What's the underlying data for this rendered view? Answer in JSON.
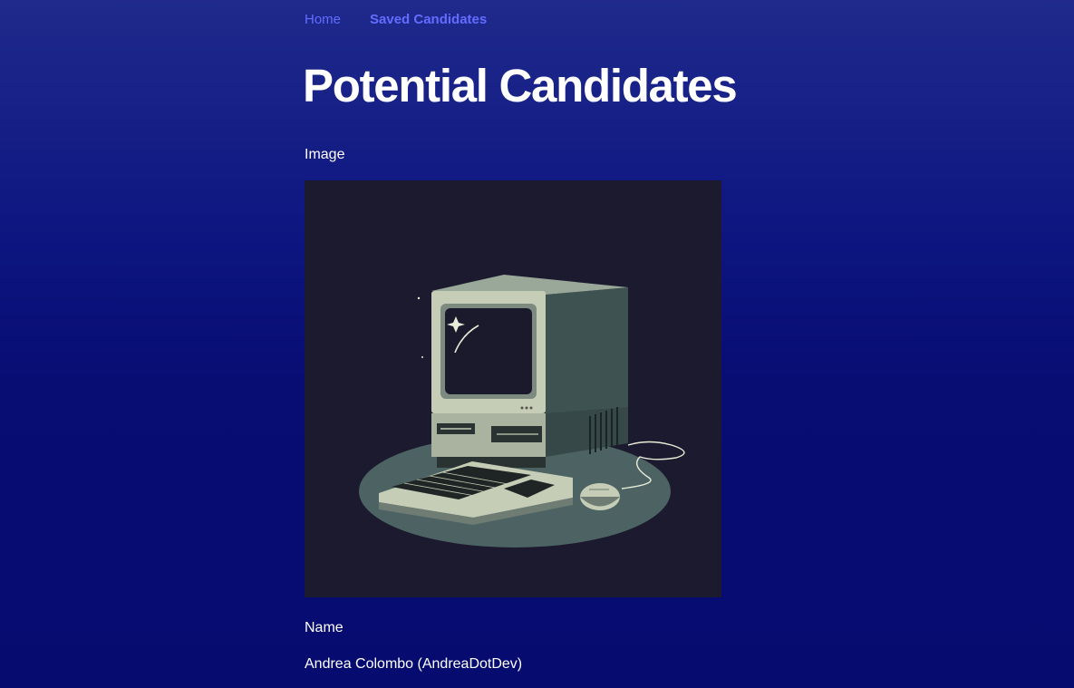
{
  "nav": {
    "home_label": "Home",
    "saved_label": "Saved Candidates"
  },
  "page": {
    "title": "Potential Candidates"
  },
  "candidate": {
    "image_label": "Image",
    "name_label": "Name",
    "name_value": "Andrea Colombo (AndreaDotDev)"
  },
  "colors": {
    "link": "#646cff",
    "background_top": "#1f2a8c",
    "background_bottom": "#060b70",
    "avatar_bg": "#1c1a2e"
  }
}
